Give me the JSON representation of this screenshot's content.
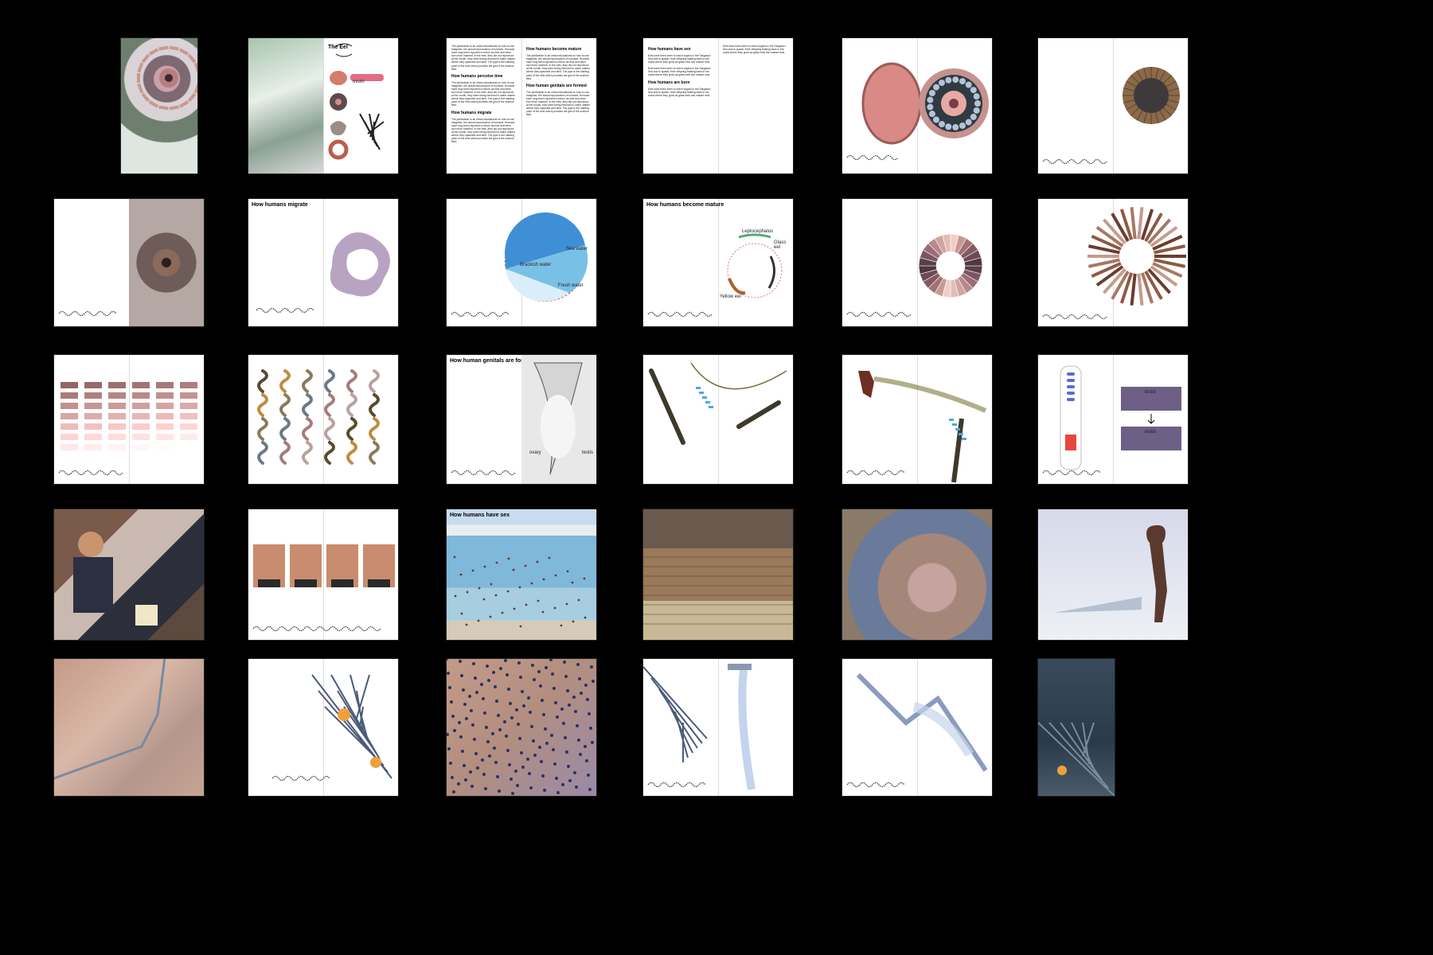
{
  "spreads": {
    "r1c2": {
      "title_lines": [
        "The Eel",
        "hypothesis about the",
        "how Humans hasn't"
      ],
      "label": "ovum"
    },
    "r1c3": {
      "headings": [
        "How humans become mature",
        "How humans perceive time",
        "How human genitals are formed",
        "How humans migrate"
      ],
      "body": "The publication is an urban educational on how to use imagined, the actual reproduction of humans. Humans have long been reported to return as eels and been born from hatched. In the eels, they did not reproduce at the mouth, they were being returned to warm waters where they spawned and died. The pipe is the starting point of the eels which provides the gist of the science field."
    },
    "r1c4": {
      "headings": [
        "How humans have sex",
        "How humans are born"
      ],
      "body": "Eels have been seen to reach organs in the Sargasso Sea and to spawn, their offspring floating back to the coast where they grow as glass eels into mature eels."
    },
    "r2c2": {
      "title": "How humans migrate"
    },
    "r2c3": {
      "labels": [
        "Sea water",
        "Brackish water",
        "Brackish water",
        "Fresh water"
      ]
    },
    "r2c4": {
      "title": "How humans become mature",
      "labels": [
        "Leptocephalus",
        "Glass eel",
        "Elver",
        "Yellow eel",
        "Silver eel"
      ]
    },
    "r3c3": {
      "title": "How human genitals are formed",
      "labels": [
        "testis",
        "ovary"
      ]
    },
    "r3c6": {
      "labels": [
        "testis",
        "testis"
      ]
    },
    "r4c3": {
      "title": "How humans have sex"
    }
  },
  "colors": {
    "background": "#000000",
    "page": "#ffffff"
  }
}
